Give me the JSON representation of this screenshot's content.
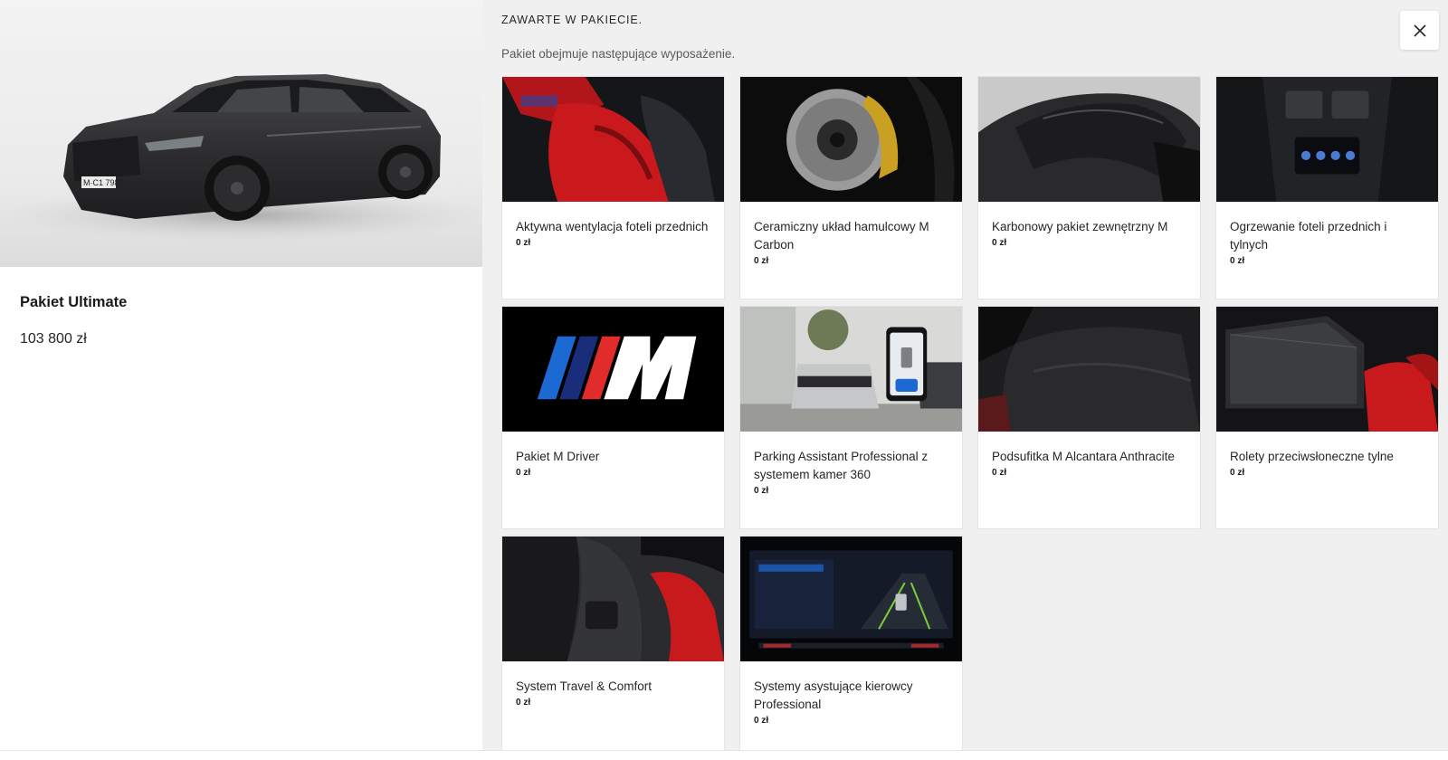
{
  "package": {
    "name": "Pakiet Ultimate",
    "price": "103 800 zł",
    "hero_plate": "M·C1 798E"
  },
  "panel": {
    "title": "ZAWARTE W PAKIECIE.",
    "subtitle": "Pakiet obejmuje następujące wyposażenie.",
    "close_icon": "close-icon"
  },
  "items": [
    {
      "title": "Aktywna wentylacja foteli przednich",
      "price": "0 zł",
      "image": "red-seat-photo"
    },
    {
      "title": "Ceramiczny układ hamulcowy M Carbon",
      "price": "0 zł",
      "image": "brake-disc-photo"
    },
    {
      "title": "Karbonowy pakiet zewnętrzny M",
      "price": "0 zł",
      "image": "carbon-roof-photo"
    },
    {
      "title": "Ogrzewanie foteli przednich i tylnych",
      "price": "0 zł",
      "image": "rear-climate-panel-photo"
    },
    {
      "title": "Pakiet M Driver",
      "price": "0 zł",
      "image": "m-logo"
    },
    {
      "title": "Parking Assistant Professional z systemem kamer 360",
      "price": "0 zł",
      "image": "parking-app-photo"
    },
    {
      "title": "Podsufitka M Alcantara Anthracite",
      "price": "0 zł",
      "image": "headliner-photo"
    },
    {
      "title": "Rolety przeciwsłoneczne tylne",
      "price": "0 zł",
      "image": "sunblind-photo"
    },
    {
      "title": "System Travel & Comfort",
      "price": "0 zł",
      "image": "seat-back-photo"
    },
    {
      "title": "Systemy asystujące kierowcy Professional",
      "price": "0 zł",
      "image": "driver-assist-display-photo"
    }
  ]
}
